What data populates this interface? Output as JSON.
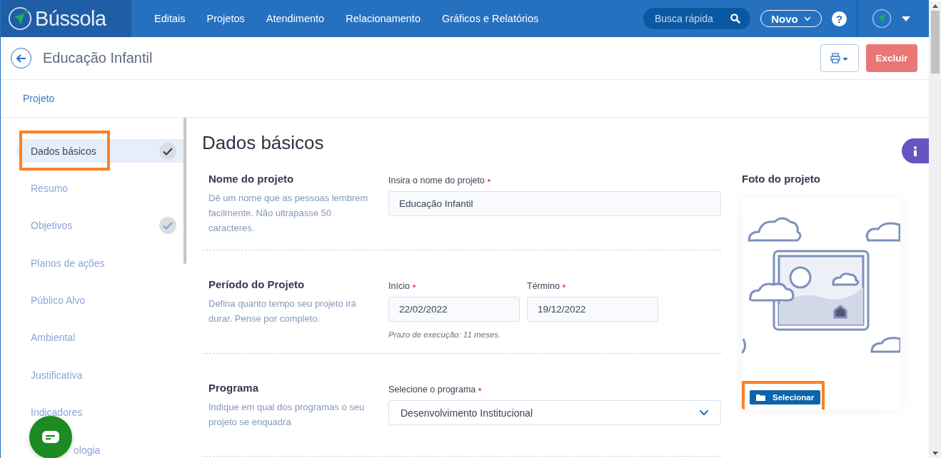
{
  "brand": {
    "name": "Bússola"
  },
  "nav": {
    "items": [
      "Editais",
      "Projetos",
      "Atendimento",
      "Relacionamento",
      "Gráficos e Relatórios"
    ],
    "search": {
      "placeholder": "Busca rápida"
    },
    "new_button": "Novo",
    "help": "?"
  },
  "header": {
    "title": "Educação Infantil",
    "delete_button": "Excluir"
  },
  "tabs": [
    {
      "label": "Projeto",
      "selected": true
    }
  ],
  "sidebar": {
    "items": [
      {
        "kind": "entry",
        "label": "Dados básicos",
        "selected": true,
        "checked": true,
        "highlighted": true
      },
      {
        "kind": "entry",
        "label": "Resumo",
        "selected": false,
        "checked": false,
        "highlighted": false
      },
      {
        "kind": "entry",
        "label": "Objetivos",
        "selected": false,
        "checked": true,
        "highlighted": false
      },
      {
        "kind": "entry",
        "label": "Planos de ações",
        "selected": false,
        "checked": false,
        "highlighted": false
      },
      {
        "kind": "entry",
        "label": "Público Alvo",
        "selected": false,
        "checked": false,
        "highlighted": false
      },
      {
        "kind": "entry",
        "label": "Ambiental",
        "selected": false,
        "checked": false,
        "highlighted": false
      },
      {
        "kind": "entry",
        "label": "Justificativa",
        "selected": false,
        "checked": false,
        "highlighted": false
      },
      {
        "kind": "entry",
        "label": "Indicadores",
        "selected": false,
        "checked": false,
        "highlighted": false
      },
      {
        "kind": "covered",
        "label": "ologia",
        "selected": false,
        "checked": false,
        "highlighted": false
      }
    ]
  },
  "main": {
    "title": "Dados básicos",
    "sections": [
      {
        "kind": "text",
        "title": "Nome do projeto",
        "description": "Dê um nome que as pessoas lembrem facilmente. Não ultrapasse 50 caracteres.",
        "fields": [
          {
            "label": "Insira o nome do projeto",
            "required": true,
            "value": "Educação Infantil"
          }
        ]
      },
      {
        "kind": "daterange",
        "title": "Período do Projeto",
        "description": "Defina quanto tempo seu projeto irá durar. Pense por completo.",
        "fields": [
          {
            "label": "Início",
            "required": true,
            "value": "22/02/2022"
          },
          {
            "label": "Término",
            "required": true,
            "value": "19/12/2022"
          }
        ],
        "note": "Prazo de execução: 11 meses."
      },
      {
        "kind": "select",
        "title": "Programa",
        "description": "Indique em qual dos programas o seu projeto se enquadra",
        "fields": [
          {
            "label": "Selecione o programa",
            "required": true,
            "value": "Desenvolvimento Institucional"
          }
        ]
      }
    ],
    "photo": {
      "title": "Foto do projeto",
      "button": "Selecionar",
      "highlighted": true
    }
  }
}
